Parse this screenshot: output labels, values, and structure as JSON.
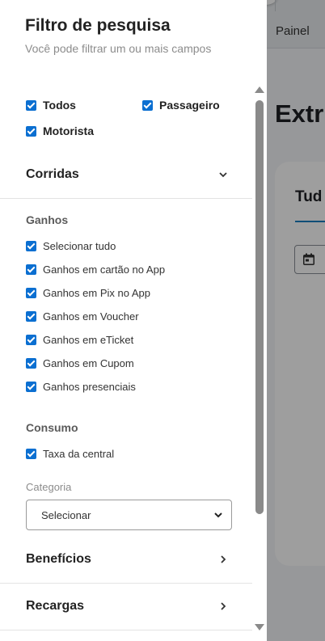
{
  "background": {
    "topbar_link": "Painel",
    "page_title": "Extr",
    "tab_label": "Tud"
  },
  "panel": {
    "title": "Filtro de pesquisa",
    "subtitle": "Você pode filtrar um ou mais campos",
    "who": {
      "todos": "Todos",
      "passageiro": "Passageiro",
      "motorista": "Motorista"
    },
    "sections": {
      "corridas": "Corridas",
      "beneficios": "Benefícios",
      "recargas": "Recargas"
    },
    "ganhos": {
      "title": "Ganhos",
      "options": [
        "Selecionar tudo",
        "Ganhos em cartão no App",
        "Ganhos em Pix no App",
        "Ganhos em Voucher",
        "Ganhos em eTicket",
        "Ganhos em Cupom",
        "Ganhos presenciais"
      ]
    },
    "consumo": {
      "title": "Consumo",
      "option": "Taxa da central"
    },
    "categoria": {
      "label": "Categoria",
      "selected": "Selecionar"
    }
  },
  "colors": {
    "checkbox": "#0b6fd1",
    "accent_underline": "#1a7fc1"
  },
  "icons": [
    "checkbox-checked-icon",
    "chevron-down-icon",
    "chevron-right-icon",
    "calendar-icon"
  ]
}
